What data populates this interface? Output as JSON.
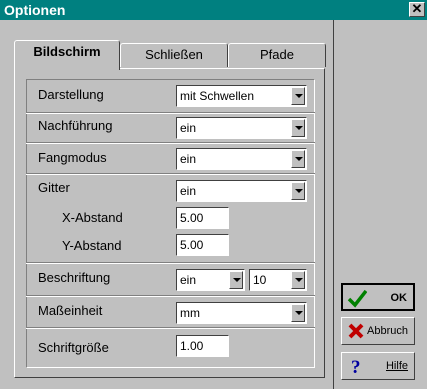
{
  "window": {
    "title": "Optionen",
    "close_glyph": "✕"
  },
  "tabs": [
    {
      "label": "Bildschirm"
    },
    {
      "label": "Schließen"
    },
    {
      "label": "Pfade"
    }
  ],
  "fields": {
    "darstellung": {
      "label": "Darstellung",
      "value": "mit Schwellen"
    },
    "nachfuehrung": {
      "label": "Nachführung",
      "value": "ein"
    },
    "fangmodus": {
      "label": "Fangmodus",
      "value": "ein"
    },
    "gitter": {
      "label": "Gitter",
      "value": "ein"
    },
    "x_abstand": {
      "label": "X-Abstand",
      "value": "5.00"
    },
    "y_abstand": {
      "label": "Y-Abstand",
      "value": "5.00"
    },
    "beschriftung": {
      "label": "Beschriftung",
      "value": "ein",
      "size_value": "10"
    },
    "masseinheit": {
      "label": "Maßeinheit",
      "value": "mm"
    },
    "schriftgroesse": {
      "label": "Schriftgröße",
      "value": "1.00"
    }
  },
  "buttons": {
    "ok": {
      "label": "OK",
      "icon": "checkmark-icon"
    },
    "abbruch": {
      "label": "Abbruch",
      "icon": "x-icon"
    },
    "hilfe": {
      "label": "Hilfe",
      "icon": "question-icon"
    }
  },
  "colors": {
    "titlebar": "#008080",
    "face": "#c0c0c0"
  }
}
